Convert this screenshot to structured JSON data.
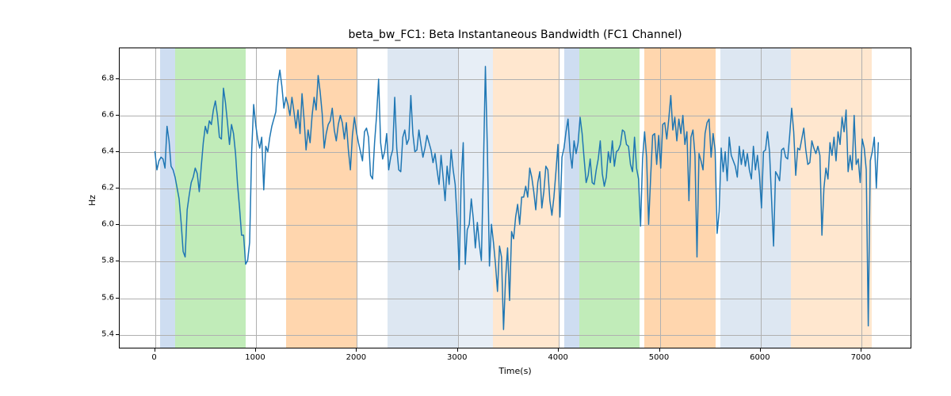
{
  "chart_data": {
    "type": "line",
    "title": "beta_bw_FC1: Beta Instantaneous Bandwidth (FC1 Channel)",
    "xlabel": "Time(s)",
    "ylabel": "Hz",
    "xlim": [
      -350,
      7500
    ],
    "ylim": [
      5.32,
      6.97
    ],
    "xticks": [
      0,
      1000,
      2000,
      3000,
      4000,
      5000,
      6000,
      7000
    ],
    "yticks": [
      5.4,
      5.6,
      5.8,
      6.0,
      6.2,
      6.4,
      6.6,
      6.8
    ],
    "bands": [
      {
        "x0": 50,
        "x1": 200,
        "color": "#aec7e8",
        "alpha": 0.6
      },
      {
        "x0": 200,
        "x1": 900,
        "color": "#98df8a",
        "alpha": 0.6
      },
      {
        "x0": 1300,
        "x1": 2000,
        "color": "#ffbb78",
        "alpha": 0.6
      },
      {
        "x0": 2300,
        "x1": 3000,
        "color": "#d7e3f0",
        "alpha": 0.85
      },
      {
        "x0": 3000,
        "x1": 3350,
        "color": "#d7e3f0",
        "alpha": 0.6
      },
      {
        "x0": 3350,
        "x1": 4000,
        "color": "#ffe3c7",
        "alpha": 0.85
      },
      {
        "x0": 4050,
        "x1": 4200,
        "color": "#aec7e8",
        "alpha": 0.6
      },
      {
        "x0": 4200,
        "x1": 4800,
        "color": "#98df8a",
        "alpha": 0.6
      },
      {
        "x0": 4850,
        "x1": 5550,
        "color": "#ffbb78",
        "alpha": 0.6
      },
      {
        "x0": 5600,
        "x1": 6300,
        "color": "#d7e3f0",
        "alpha": 0.85
      },
      {
        "x0": 6300,
        "x1": 7100,
        "color": "#ffe3c7",
        "alpha": 0.85
      }
    ],
    "series": [
      {
        "name": "beta_bw_FC1",
        "color": "#1f77b4",
        "x_start": 0,
        "x_step": 20,
        "values": [
          6.4,
          6.3,
          6.35,
          6.37,
          6.36,
          6.31,
          6.54,
          6.46,
          6.32,
          6.3,
          6.26,
          6.2,
          6.14,
          6.01,
          5.85,
          5.82,
          6.08,
          6.16,
          6.23,
          6.26,
          6.31,
          6.28,
          6.18,
          6.32,
          6.45,
          6.54,
          6.5,
          6.57,
          6.55,
          6.63,
          6.68,
          6.6,
          6.48,
          6.47,
          6.75,
          6.67,
          6.56,
          6.44,
          6.55,
          6.5,
          6.39,
          6.22,
          6.09,
          5.94,
          5.94,
          5.78,
          5.8,
          5.9,
          6.4,
          6.66,
          6.55,
          6.47,
          6.42,
          6.48,
          6.19,
          6.43,
          6.4,
          6.48,
          6.54,
          6.58,
          6.62,
          6.78,
          6.85,
          6.76,
          6.64,
          6.7,
          6.66,
          6.6,
          6.7,
          6.62,
          6.53,
          6.63,
          6.5,
          6.72,
          6.58,
          6.41,
          6.52,
          6.45,
          6.6,
          6.7,
          6.63,
          6.82,
          6.73,
          6.61,
          6.42,
          6.5,
          6.55,
          6.57,
          6.64,
          6.52,
          6.46,
          6.55,
          6.6,
          6.56,
          6.47,
          6.56,
          6.41,
          6.3,
          6.49,
          6.59,
          6.51,
          6.45,
          6.4,
          6.35,
          6.51,
          6.53,
          6.48,
          6.27,
          6.25,
          6.45,
          6.6,
          6.8,
          6.45,
          6.36,
          6.4,
          6.5,
          6.3,
          6.37,
          6.41,
          6.7,
          6.42,
          6.3,
          6.29,
          6.48,
          6.52,
          6.44,
          6.47,
          6.71,
          6.5,
          6.4,
          6.41,
          6.52,
          6.44,
          6.37,
          6.42,
          6.49,
          6.45,
          6.41,
          6.34,
          6.39,
          6.3,
          6.22,
          6.38,
          6.26,
          6.13,
          6.32,
          6.22,
          6.41,
          6.3,
          6.22,
          6.02,
          5.75,
          6.25,
          6.45,
          5.78,
          5.97,
          6.0,
          6.14,
          6.03,
          5.87,
          6.01,
          5.89,
          5.8,
          6.3,
          6.87,
          6.4,
          5.77,
          6.0,
          5.9,
          5.78,
          5.63,
          5.88,
          5.82,
          5.42,
          5.7,
          5.87,
          5.58,
          5.96,
          5.92,
          6.04,
          6.11,
          6.0,
          6.15,
          6.15,
          6.21,
          6.15,
          6.31,
          6.26,
          6.18,
          6.08,
          6.23,
          6.29,
          6.09,
          6.18,
          6.32,
          6.3,
          6.13,
          6.05,
          6.15,
          6.29,
          6.44,
          6.04,
          6.37,
          6.42,
          6.51,
          6.58,
          6.4,
          6.31,
          6.46,
          6.39,
          6.45,
          6.59,
          6.5,
          6.36,
          6.23,
          6.27,
          6.36,
          6.23,
          6.22,
          6.3,
          6.36,
          6.46,
          6.28,
          6.21,
          6.26,
          6.4,
          6.34,
          6.46,
          6.32,
          6.4,
          6.41,
          6.44,
          6.52,
          6.51,
          6.44,
          6.43,
          6.33,
          6.29,
          6.48,
          6.31,
          6.25,
          5.99,
          6.36,
          6.51,
          6.37,
          6.0,
          6.26,
          6.49,
          6.5,
          6.33,
          6.49,
          6.31,
          6.55,
          6.56,
          6.47,
          6.58,
          6.71,
          6.52,
          6.59,
          6.46,
          6.58,
          6.5,
          6.6,
          6.44,
          6.51,
          6.13,
          6.48,
          6.52,
          6.38,
          5.82,
          6.39,
          6.35,
          6.3,
          6.5,
          6.56,
          6.58,
          6.37,
          6.5,
          6.41,
          5.95,
          6.07,
          6.42,
          6.29,
          6.4,
          6.24,
          6.48,
          6.38,
          6.35,
          6.32,
          6.26,
          6.43,
          6.33,
          6.41,
          6.32,
          6.39,
          6.3,
          6.25,
          6.43,
          6.3,
          6.38,
          6.27,
          6.09,
          6.4,
          6.41,
          6.51,
          6.4,
          6.14,
          5.88,
          6.29,
          6.27,
          6.24,
          6.41,
          6.42,
          6.37,
          6.36,
          6.49,
          6.64,
          6.51,
          6.27,
          6.42,
          6.41,
          6.47,
          6.53,
          6.41,
          6.33,
          6.34,
          6.46,
          6.42,
          6.39,
          6.43,
          6.38,
          5.94,
          6.2,
          6.31,
          6.25,
          6.45,
          6.38,
          6.48,
          6.35,
          6.51,
          6.44,
          6.59,
          6.51,
          6.63,
          6.29,
          6.38,
          6.3,
          6.6,
          6.33,
          6.36,
          6.23,
          6.47,
          6.42,
          6.3,
          5.44,
          6.35,
          6.4,
          6.48,
          6.2,
          6.45
        ]
      }
    ]
  },
  "layout": {
    "ax_left": 150,
    "ax_top": 60,
    "ax_width": 1000,
    "ax_height": 380
  }
}
